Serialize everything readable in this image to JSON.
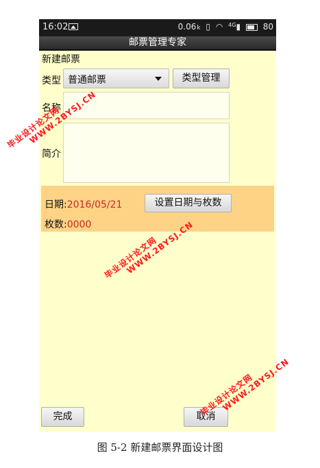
{
  "status_bar": {
    "time": "16:02",
    "speed": "0.06",
    "speed_unit": "k",
    "signal": "4G",
    "battery": "80"
  },
  "app_title": "邮票管理专家",
  "form": {
    "heading": "新建邮票",
    "type_label": "类型",
    "type_value": "普通邮票",
    "type_manage_button": "类型管理",
    "name_label": "名称",
    "name_value": "",
    "intro_label": "简介",
    "intro_value": ""
  },
  "info_panel": {
    "date_label": "日期:",
    "date_value": "2016/05/21",
    "set_button": "设置日期与枚数",
    "count_label": "枚数:",
    "count_value": "0000"
  },
  "footer": {
    "finish_button": "完成",
    "cancel_button": "取消"
  },
  "watermark": {
    "line1": "毕业设计论文网",
    "line2": "WWW.2BYSJ.CN"
  },
  "caption": "图 5-2 新建邮票界面设计图"
}
